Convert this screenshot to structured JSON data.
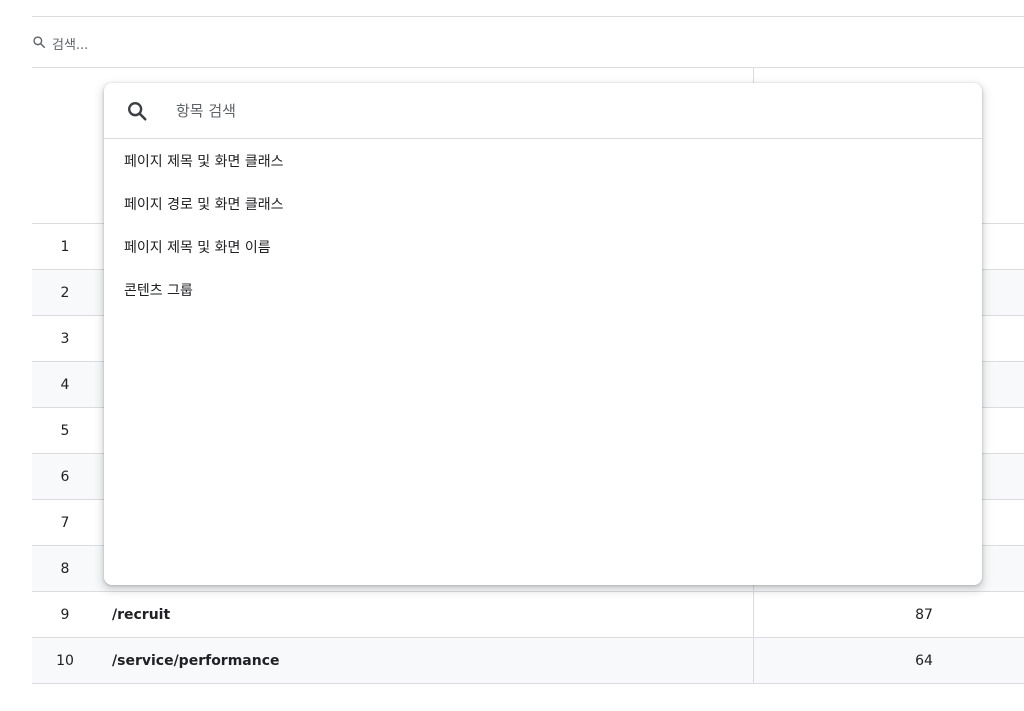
{
  "search": {
    "placeholder": "검색..."
  },
  "dropdown": {
    "search_placeholder": "항목 검색",
    "items": [
      "페이지 제목 및 화면 클래스",
      "페이지 경로 및 화면 클래스",
      "페이지 제목 및 화면 이름",
      "콘텐츠 그룹"
    ]
  },
  "table": {
    "rows": [
      {
        "rank": "1",
        "path": "",
        "value": ""
      },
      {
        "rank": "2",
        "path": "",
        "value": ""
      },
      {
        "rank": "3",
        "path": "",
        "value": ""
      },
      {
        "rank": "4",
        "path": "",
        "value": ""
      },
      {
        "rank": "5",
        "path": "",
        "value": ""
      },
      {
        "rank": "6",
        "path": "",
        "value": ""
      },
      {
        "rank": "7",
        "path": "",
        "value": ""
      },
      {
        "rank": "8",
        "path": "",
        "value": ""
      },
      {
        "rank": "9",
        "path": "/recruit",
        "value": "87"
      },
      {
        "rank": "10",
        "path": "/service/performance",
        "value": "64"
      }
    ]
  }
}
